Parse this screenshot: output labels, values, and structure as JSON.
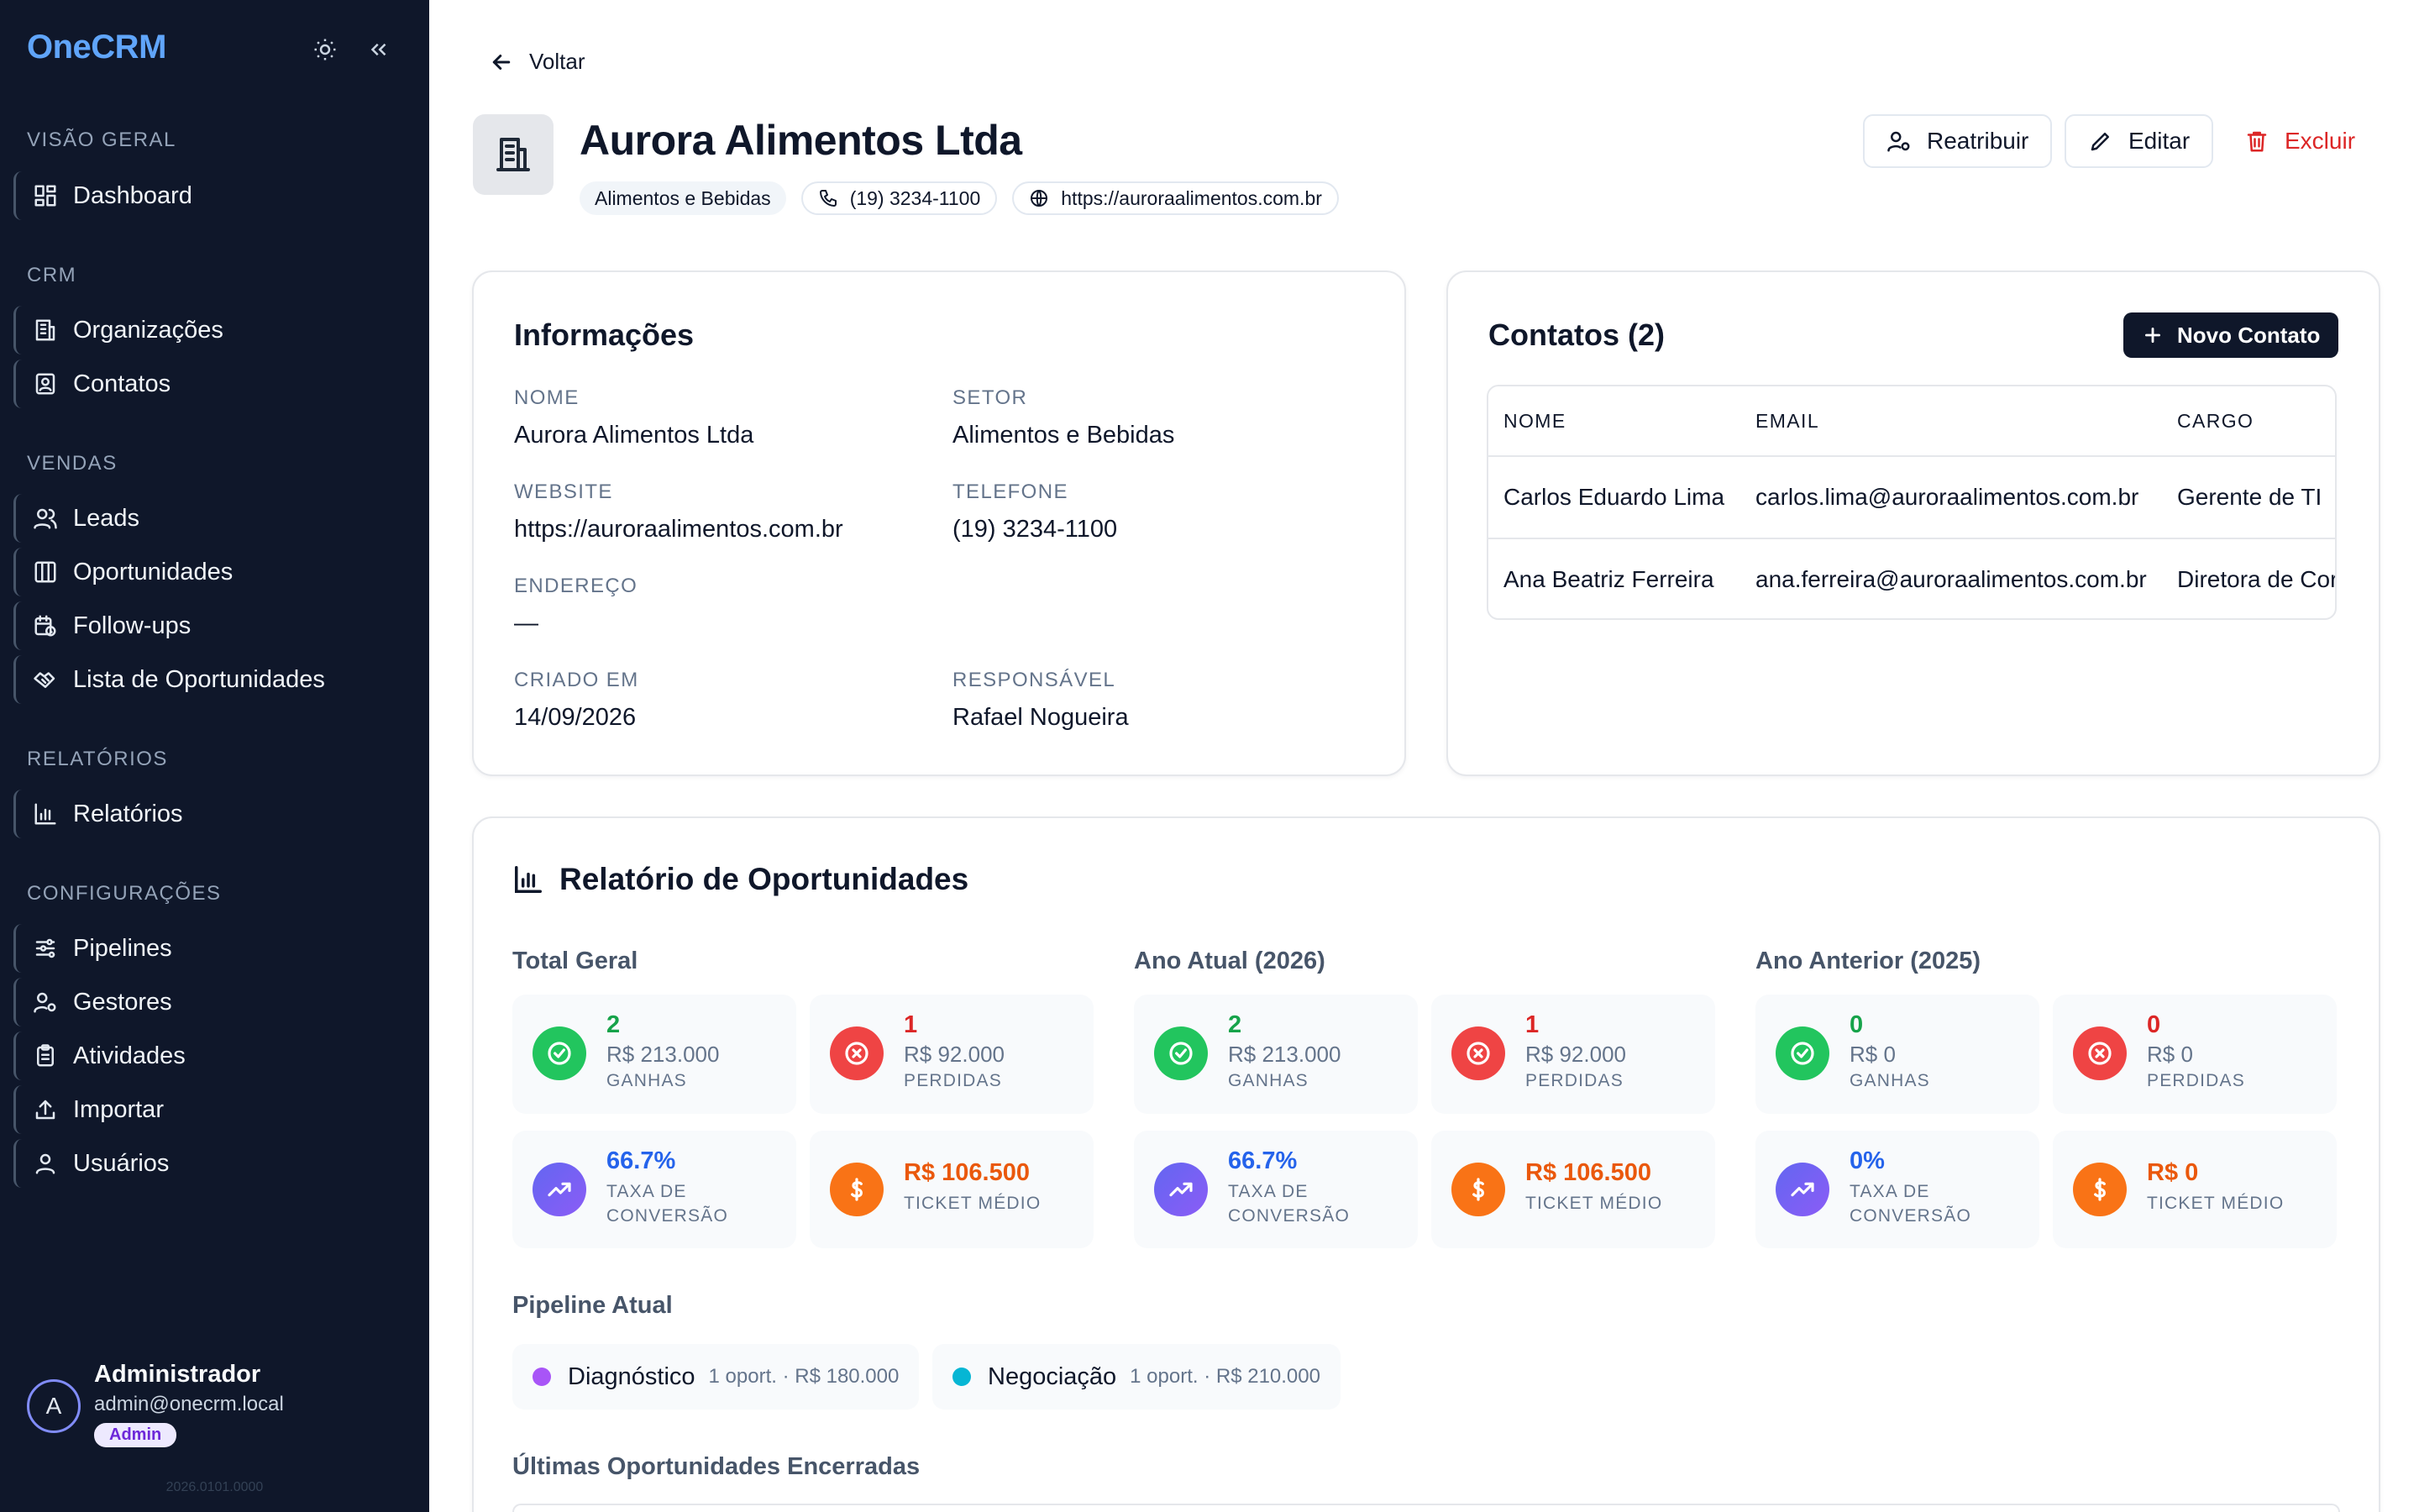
{
  "sidebar": {
    "brand": "OneCRM",
    "sections": [
      {
        "title": "VISÃO GERAL",
        "items": [
          {
            "label": "Dashboard",
            "icon": "dashboard-icon"
          }
        ]
      },
      {
        "title": "CRM",
        "items": [
          {
            "label": "Organizações",
            "icon": "building-icon"
          },
          {
            "label": "Contatos",
            "icon": "contact-card-icon"
          }
        ]
      },
      {
        "title": "VENDAS",
        "items": [
          {
            "label": "Leads",
            "icon": "users-icon"
          },
          {
            "label": "Oportunidades",
            "icon": "kanban-icon"
          },
          {
            "label": "Follow-ups",
            "icon": "calendar-clock-icon"
          },
          {
            "label": "Lista de Oportunidades",
            "icon": "handshake-icon"
          }
        ]
      },
      {
        "title": "RELATÓRIOS",
        "items": [
          {
            "label": "Relatórios",
            "icon": "bar-chart-icon"
          }
        ]
      },
      {
        "title": "CONFIGURAÇÕES",
        "items": [
          {
            "label": "Pipelines",
            "icon": "sliders-icon"
          },
          {
            "label": "Gestores",
            "icon": "user-cog-icon"
          },
          {
            "label": "Atividades",
            "icon": "clipboard-icon"
          },
          {
            "label": "Importar",
            "icon": "upload-icon"
          },
          {
            "label": "Usuários",
            "icon": "user-icon"
          }
        ]
      }
    ],
    "user": {
      "initial": "A",
      "name": "Administrador",
      "email": "admin@onecrm.local",
      "badge": "Admin"
    },
    "version": "2026.0101.0000"
  },
  "header": {
    "back_label": "Voltar",
    "title": "Aurora Alimentos Ltda",
    "chips": {
      "sector": "Alimentos e Bebidas",
      "phone": "(19) 3234-1100",
      "website": "https://auroraalimentos.com.br"
    },
    "actions": {
      "reassign": "Reatribuir",
      "edit": "Editar",
      "delete": "Excluir"
    }
  },
  "info": {
    "title": "Informações",
    "fields": {
      "nome_label": "NOME",
      "nome": "Aurora Alimentos Ltda",
      "setor_label": "SETOR",
      "setor": "Alimentos e Bebidas",
      "website_label": "WEBSITE",
      "website": "https://auroraalimentos.com.br",
      "telefone_label": "TELEFONE",
      "telefone": "(19) 3234-1100",
      "endereco_label": "ENDEREÇO",
      "endereco": "—",
      "criado_label": "CRIADO EM",
      "criado": "14/09/2026",
      "responsavel_label": "RESPONSÁVEL",
      "responsavel": "Rafael Nogueira"
    }
  },
  "contacts": {
    "title": "Contatos (2)",
    "new_button": "Novo Contato",
    "columns": [
      "NOME",
      "EMAIL",
      "CARGO"
    ],
    "rows": [
      {
        "nome": "Carlos Eduardo Lima",
        "email": "carlos.lima@auroraalimentos.com.br",
        "cargo": "Gerente de TI"
      },
      {
        "nome": "Ana Beatriz Ferreira",
        "email": "ana.ferreira@auroraalimentos.com.br",
        "cargo": "Diretora de Cor"
      }
    ]
  },
  "report": {
    "title": "Relatório de Oportunidades",
    "groups": [
      {
        "label": "Total Geral",
        "won_count": "2",
        "won_value": "R$ 213.000",
        "won_label": "GANHAS",
        "lost_count": "1",
        "lost_value": "R$ 92.000",
        "lost_label": "PERDIDAS",
        "conv": "66.7%",
        "conv_label": "TAXA DE CONVERSÃO",
        "ticket": "R$ 106.500",
        "ticket_label": "TICKET MÉDIO"
      },
      {
        "label": "Ano Atual (2026)",
        "won_count": "2",
        "won_value": "R$ 213.000",
        "won_label": "GANHAS",
        "lost_count": "1",
        "lost_value": "R$ 92.000",
        "lost_label": "PERDIDAS",
        "conv": "66.7%",
        "conv_label": "TAXA DE CONVERSÃO",
        "ticket": "R$ 106.500",
        "ticket_label": "TICKET MÉDIO"
      },
      {
        "label": "Ano Anterior (2025)",
        "won_count": "0",
        "won_value": "R$ 0",
        "won_label": "GANHAS",
        "lost_count": "0",
        "lost_value": "R$ 0",
        "lost_label": "PERDIDAS",
        "conv": "0%",
        "conv_label": "TAXA DE CONVERSÃO",
        "ticket": "R$ 0",
        "ticket_label": "TICKET MÉDIO"
      }
    ],
    "pipeline_label": "Pipeline Atual",
    "pipeline": [
      {
        "name": "Diagnóstico",
        "meta": "1 oport. · R$ 180.000",
        "color": "#a855f7"
      },
      {
        "name": "Negociação",
        "meta": "1 oport. · R$ 210.000",
        "color": "#06b6d4"
      }
    ],
    "closed_label": "Últimas Oportunidades Encerradas"
  },
  "colors": {
    "won": "#16a34a",
    "lost": "#dc2626",
    "conv": "#2563eb",
    "ticket": "#ea580c"
  }
}
